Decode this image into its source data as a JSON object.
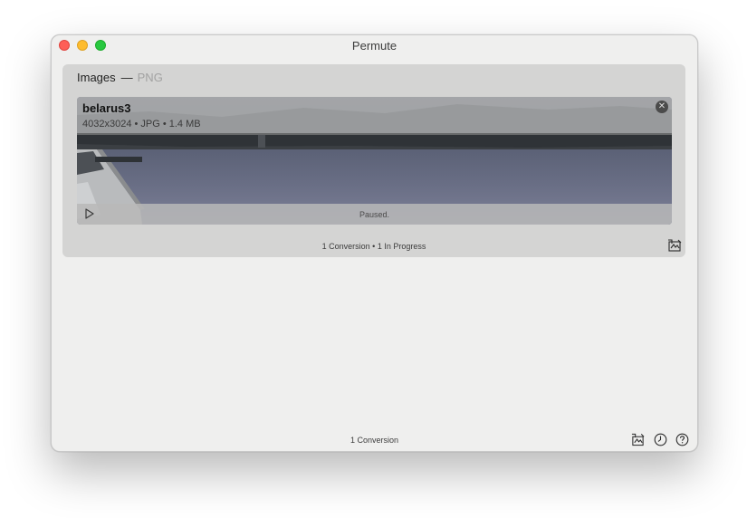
{
  "window": {
    "title": "Permute"
  },
  "group": {
    "title": "Images",
    "separator": "—",
    "format": "PNG",
    "footer": "1 Conversion • 1 In Progress"
  },
  "item": {
    "name": "belarus3",
    "meta": "4032x3024 • JPG • 1.4 MB",
    "status": "Paused."
  },
  "footer": {
    "status": "1 Conversion"
  },
  "icons": {
    "remove": "close-circle-icon",
    "play": "play-icon",
    "convert": "convert-icon",
    "history": "clock-icon",
    "help": "question-icon"
  },
  "colors": {
    "close": "#fe5f57",
    "minimize": "#febc2e",
    "maximize": "#28c840"
  }
}
